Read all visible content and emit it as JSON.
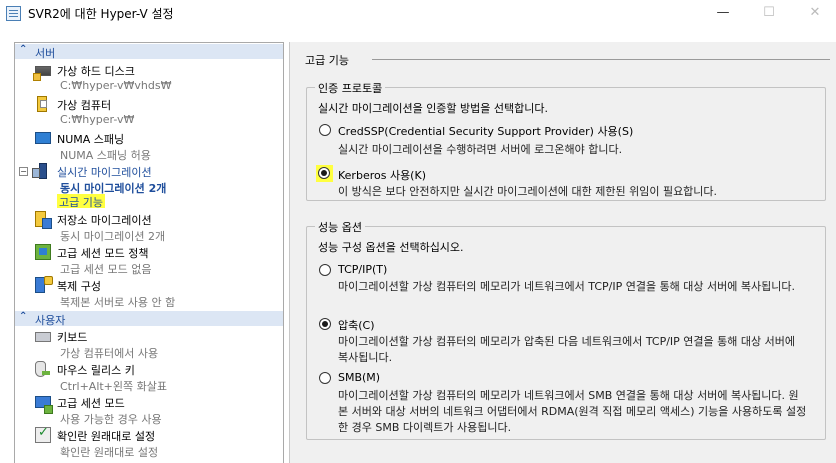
{
  "window": {
    "title": "SVR2에 대한 Hyper-V 설정",
    "minimize_glyph": "—",
    "maximize_glyph": "☐",
    "close_glyph": "✕"
  },
  "tree": {
    "sections": [
      {
        "label": "서버",
        "icon": "chevron-up-icon"
      },
      {
        "label": "사용자",
        "icon": "chevron-up-icon"
      }
    ],
    "expand_glyph": "−",
    "items": [
      {
        "label": "가상 하드 디스크",
        "sub": "C:₩hyper-v₩vhds₩",
        "icon": "hard-disk-icon"
      },
      {
        "label": "가상 컴퓨터",
        "sub": "C:₩hyper-v₩",
        "icon": "virtual-machine-icon"
      },
      {
        "label": "NUMA 스패닝",
        "sub": "NUMA 스패닝 허용",
        "icon": "numa-icon"
      },
      {
        "label": "실시간 마이그레이션",
        "sub": "동시 마이그레이션 2개",
        "icon": "live-migration-icon",
        "child": "고급 기능"
      },
      {
        "label": "저장소 마이그레이션",
        "sub": "동시 마이그레이션 2개",
        "icon": "storage-migration-icon"
      },
      {
        "label": "고급 세션 모드 정책",
        "sub": "고급 세션 모드 없음",
        "icon": "session-policy-icon"
      },
      {
        "label": "복제 구성",
        "sub": "복제본 서버로 사용 안 함",
        "icon": "replication-icon"
      },
      {
        "label": "키보드",
        "sub": "가상 컴퓨터에서 사용",
        "icon": "keyboard-icon"
      },
      {
        "label": "마우스 릴리스 키",
        "sub": "Ctrl+Alt+왼쪽 화살표",
        "icon": "mouse-icon"
      },
      {
        "label": "고급 세션 모드",
        "sub": "사용 가능한 경우 사용",
        "icon": "enhanced-session-icon"
      },
      {
        "label": "확인란 원래대로 설정",
        "sub": "확인란 원래대로 설정",
        "icon": "reset-checkbox-icon"
      }
    ]
  },
  "panel": {
    "heading": "고급 기능",
    "auth": {
      "title": "인증 프로토콜",
      "instruction": "실시간 마이그레이션을 인증할 방법을 선택합니다.",
      "options": [
        {
          "label": "CredSSP(Credential Security Support Provider) 사용(S)",
          "desc": "실시간 마이그레이션을 수행하려면 서버에 로그온해야 합니다.",
          "checked": false
        },
        {
          "label": "Kerberos 사용(K)",
          "desc": "이 방식은 보다 안전하지만 실시간 마이그레이션에 대한 제한된 위임이 필요합니다.",
          "checked": true
        }
      ]
    },
    "performance": {
      "title": "성능 옵션",
      "instruction": "성능 구성 옵션을 선택하십시오.",
      "options": [
        {
          "label": "TCP/IP(T)",
          "desc": "마이그레이션할 가상 컴퓨터의 메모리가 네트워크에서 TCP/IP 연결을 통해 대상 서버에 복사됩니다.",
          "checked": false
        },
        {
          "label": "압축(C)",
          "desc": "마이그레이션할 가상 컴퓨터의 메모리가 압축된 다음 네트워크에서 TCP/IP 연결을 통해 대상 서버에 복사됩니다.",
          "checked": true
        },
        {
          "label": "SMB(M)",
          "desc": "마이그레이션할 가상 컴퓨터의 메모리가 네트워크에서 SMB 연결을 통해 대상 서버에 복사됩니다. 원본 서버와 대상 서버의 네트워크 어댑터에서 RDMA(원격 직접 메모리 액세스) 기능을 사용하도록 설정한 경우 SMB 다이렉트가 사용됩니다.",
          "checked": false
        }
      ]
    }
  },
  "colors": {
    "accent": "#1f4e9c",
    "highlight": "#ffff40",
    "section_bg": "#dce6f4",
    "panel_bg": "#f0f0f0"
  }
}
